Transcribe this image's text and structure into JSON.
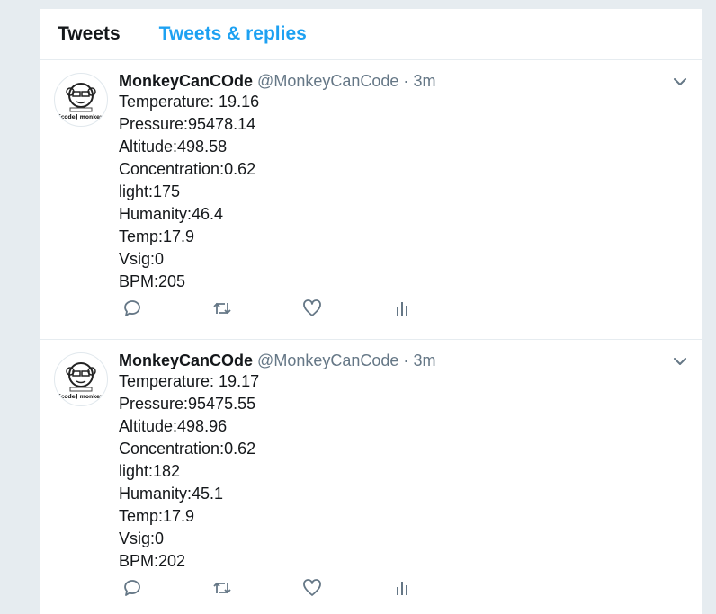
{
  "tabs": [
    {
      "label": "Tweets",
      "active": true
    },
    {
      "label": "Tweets & replies",
      "active": false
    }
  ],
  "avatar_text": "[code] monkey",
  "tweets": [
    {
      "name": "MonkeyCanCOde",
      "handle": "@MonkeyCanCode",
      "separator": "·",
      "time": "3m",
      "lines": [
        "Temperature: 19.16",
        "Pressure:95478.14",
        "Altitude:498.58",
        "Concentration:0.62",
        "light:175",
        "Humanity:46.4",
        "Temp:17.9",
        "Vsig:0",
        "BPM:205"
      ]
    },
    {
      "name": "MonkeyCanCOde",
      "handle": "@MonkeyCanCode",
      "separator": "·",
      "time": "3m",
      "lines": [
        "Temperature: 19.17",
        "Pressure:95475.55",
        "Altitude:498.96",
        "Concentration:0.62",
        "light:182",
        "Humanity:45.1",
        "Temp:17.9",
        "Vsig:0",
        "BPM:202"
      ]
    }
  ],
  "icons": {
    "caret": "chevron-down-icon",
    "reply": "reply-icon",
    "retweet": "retweet-icon",
    "like": "heart-icon",
    "analytics": "analytics-icon"
  },
  "colors": {
    "accent": "#1da1f2",
    "muted": "#657786",
    "text": "#14171a",
    "page_bg": "#e6ecf0"
  }
}
